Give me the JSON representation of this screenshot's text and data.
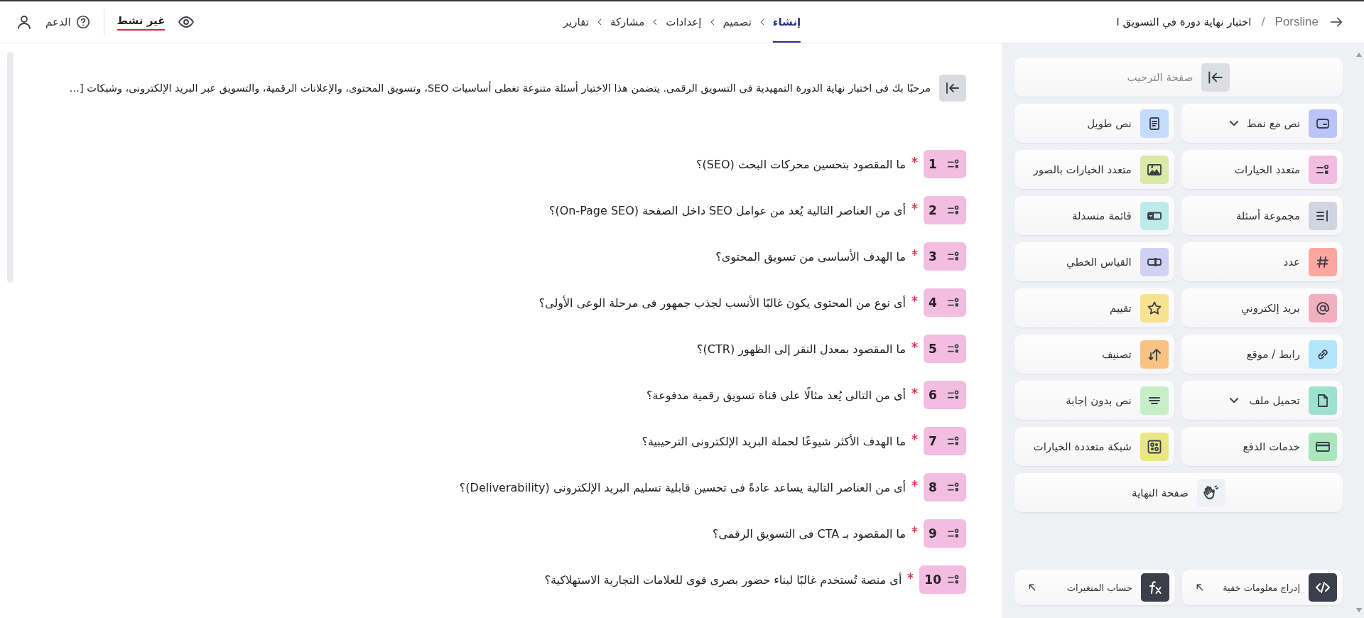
{
  "header": {
    "brand": "Porsline",
    "separator": "/",
    "title": "اختبار نهاية دورة في التسويق ا",
    "steps": [
      {
        "label": "إنشاء",
        "selected": true
      },
      {
        "label": "تصميم",
        "selected": false
      },
      {
        "label": "إعدادات",
        "selected": false
      },
      {
        "label": "مشاركة",
        "selected": false
      },
      {
        "label": "تقارير",
        "selected": false
      }
    ],
    "status": "غير نشط",
    "support": "الدعم"
  },
  "welcome": {
    "text": "مرحبًا بك فى اختبار نهاية الدورة التمهيدية فى التسويق الرقمى. يتضمن هذا الاختبار أسئلة متنوعة تغطى أساسيات SEO، وتسويق المحتوى، والإعلانات الرقمية، والتسويق عبر البريد الإلكترونى، وشبكات […"
  },
  "questions": [
    {
      "number": "1",
      "text": "ما المقصود بتحسين محركات البحث (SEO)؟",
      "required": true
    },
    {
      "number": "2",
      "text": "أى من العناصر التالية يُعد من عوامل SEO داخل الصفحة (On-Page SEO)؟",
      "required": true
    },
    {
      "number": "3",
      "text": "ما الهدف الأساسى من تسويق المحتوى؟",
      "required": true
    },
    {
      "number": "4",
      "text": "أى نوع من المحتوى يكون غالبًا الأنسب لجذب جمهور فى مرحلة الوعى الأولى؟",
      "required": true
    },
    {
      "number": "5",
      "text": "ما المقصود بمعدل النقر إلى الظهور (CTR)؟",
      "required": true
    },
    {
      "number": "6",
      "text": "أى من التالى يُعد مثالًا على قناة تسويق رقمية مدفوعة؟",
      "required": true
    },
    {
      "number": "7",
      "text": "ما الهدف الأكثر شيوعًا لحملة البريد الإلكترونى الترحيبية؟",
      "required": true
    },
    {
      "number": "8",
      "text": "أى من العناصر التالية يساعد عادةً فى تحسين قابلية تسليم البريد الإلكترونى (Deliverability)؟",
      "required": true
    },
    {
      "number": "9",
      "text": "ما المقصود بـ CTA فى التسويق الرقمى؟",
      "required": true
    },
    {
      "number": "10",
      "text": "أى منصة تُستخدم غالبًا لبناء حضور بصرى قوى للعلامات التجارية الاستهلاكية؟",
      "required": true
    }
  ],
  "sidebar": {
    "welcome_page": {
      "label": "صفحة الترحيب",
      "disabled": true
    },
    "question_types": [
      {
        "label": "نص مع نمط",
        "kind": "styled-text",
        "color": "#bac4f8",
        "expandable": true
      },
      {
        "label": "نص طويل",
        "kind": "long-text",
        "color": "#c3dbfc",
        "expandable": false
      },
      {
        "label": "متعدد الخيارات",
        "kind": "multiple-choice",
        "color": "#f2bde0",
        "expandable": false
      },
      {
        "label": "متعدد الخيارات بالصور",
        "kind": "picture-choice",
        "color": "#dbe8a6",
        "expandable": false
      },
      {
        "label": "مجموعة أسئلة",
        "kind": "question-group",
        "color": "#d1d5e0",
        "expandable": false
      },
      {
        "label": "قائمة منسدلة",
        "kind": "dropdown",
        "color": "#bdebea",
        "expandable": false
      },
      {
        "label": "عدد",
        "kind": "number",
        "color": "#fca6a0",
        "expandable": false
      },
      {
        "label": "القياس الخطي",
        "kind": "linear-scale",
        "color": "#cfd2f2",
        "expandable": false
      },
      {
        "label": "بريد إلكتروني",
        "kind": "email",
        "color": "#f2afc0",
        "expandable": false
      },
      {
        "label": "تقييم",
        "kind": "rating",
        "color": "#f8e190",
        "expandable": false
      },
      {
        "label": "رابط / موقع",
        "kind": "link",
        "color": "#b3e5fc",
        "expandable": false
      },
      {
        "label": "تصنيف",
        "kind": "ranking",
        "color": "#f8c282",
        "expandable": false
      },
      {
        "label": "تحميل ملف",
        "kind": "file-upload",
        "color": "#9ee1d0",
        "expandable": true
      },
      {
        "label": "نص بدون إجابة",
        "kind": "statement",
        "color": "#c7eec7",
        "expandable": false
      },
      {
        "label": "خدمات الدفع",
        "kind": "payment",
        "color": "#a9e6be",
        "expandable": false
      },
      {
        "label": "شبكة متعددة الخيارات",
        "kind": "matrix",
        "color": "#e8e685",
        "expandable": false
      }
    ],
    "end_page": {
      "label": "صفحة النهاية",
      "disabled": false
    },
    "tools": [
      {
        "label": "إدراج معلومات خفية",
        "kind": "hidden-fields"
      },
      {
        "label": "حساب المتغيرات",
        "kind": "variables"
      }
    ]
  }
}
